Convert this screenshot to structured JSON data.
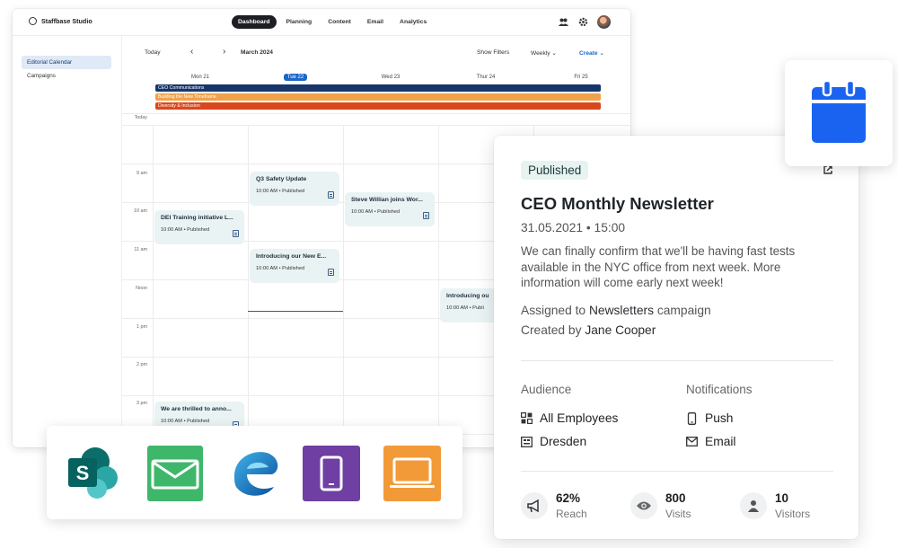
{
  "app": {
    "brand": "Staffbase Studio",
    "nav": [
      "Dashboard",
      "Planning",
      "Content",
      "Email",
      "Analytics"
    ],
    "active_nav": "Dashboard",
    "sidebar": [
      "Editorial Calendar",
      "Campaigns"
    ],
    "toolbar": {
      "today": "Today",
      "month": "March 2024",
      "show_filters": "Show Filters",
      "view": "Weekly",
      "create": "Create"
    },
    "days": [
      "Mon 21",
      "Tue 22",
      "Wed 23",
      "Thur 24",
      "Fri 25"
    ],
    "today_row": "Today",
    "allday": [
      {
        "label": "CEO Communications",
        "color": "#17356b"
      },
      {
        "label": "Building the New Timeframe",
        "color": "#efa24b"
      },
      {
        "label": "Diversity & Inclusion",
        "color": "#d9481d"
      }
    ],
    "times": [
      "9 am",
      "10 am",
      "11 am",
      "Noon",
      "1 pm",
      "2 pm",
      "3 pm"
    ],
    "events": [
      {
        "title": "Q3 Safety Update",
        "meta": "10:00 AM • Published"
      },
      {
        "title": "Steve Willian joins Wor...",
        "meta": "10:00 AM • Published"
      },
      {
        "title": "DEI Training initiative L...",
        "meta": "10:00 AM • Published"
      },
      {
        "title": "Introducing our New E...",
        "meta": "10:00 AM • Published"
      },
      {
        "title": "Introducing ou",
        "meta": "10:00 AM • Publi"
      },
      {
        "title": "We are thrilled to anno...",
        "meta": "10:00 AM • Published"
      }
    ]
  },
  "channels": [
    {
      "name": "sharepoint-icon",
      "color": "#0b7a75"
    },
    {
      "name": "email-icon",
      "color": "#3fb76b"
    },
    {
      "name": "edge-browser-icon",
      "color": "#1a73c8"
    },
    {
      "name": "mobile-app-icon",
      "color": "#6f3fa3"
    },
    {
      "name": "desktop-laptop-icon",
      "color": "#f29a38"
    }
  ],
  "card": {
    "badge": "Published",
    "title": "CEO Monthly Newsletter",
    "datetime": "31.05.2021 • 15:00",
    "body": "We can finally confirm that we'll be having fast tests available in the NYC office from next week. More information will come early next week!",
    "assigned_prefix": "Assigned to ",
    "assigned_campaign": "Newsletters",
    "assigned_suffix": " campaign",
    "created_prefix": "Created by ",
    "created_by": "Jane Cooper",
    "audience_label": "Audience",
    "audience": [
      "All Employees",
      "Dresden"
    ],
    "notifications_label": "Notifications",
    "notifications": [
      "Push",
      "Email"
    ],
    "stats": [
      {
        "value": "62%",
        "label": "Reach"
      },
      {
        "value": "800",
        "label": "Visits"
      },
      {
        "value": "10",
        "label": "Visitors"
      }
    ]
  },
  "calendar_tile": {
    "icon": "calendar-icon",
    "color": "#1a63f0"
  }
}
